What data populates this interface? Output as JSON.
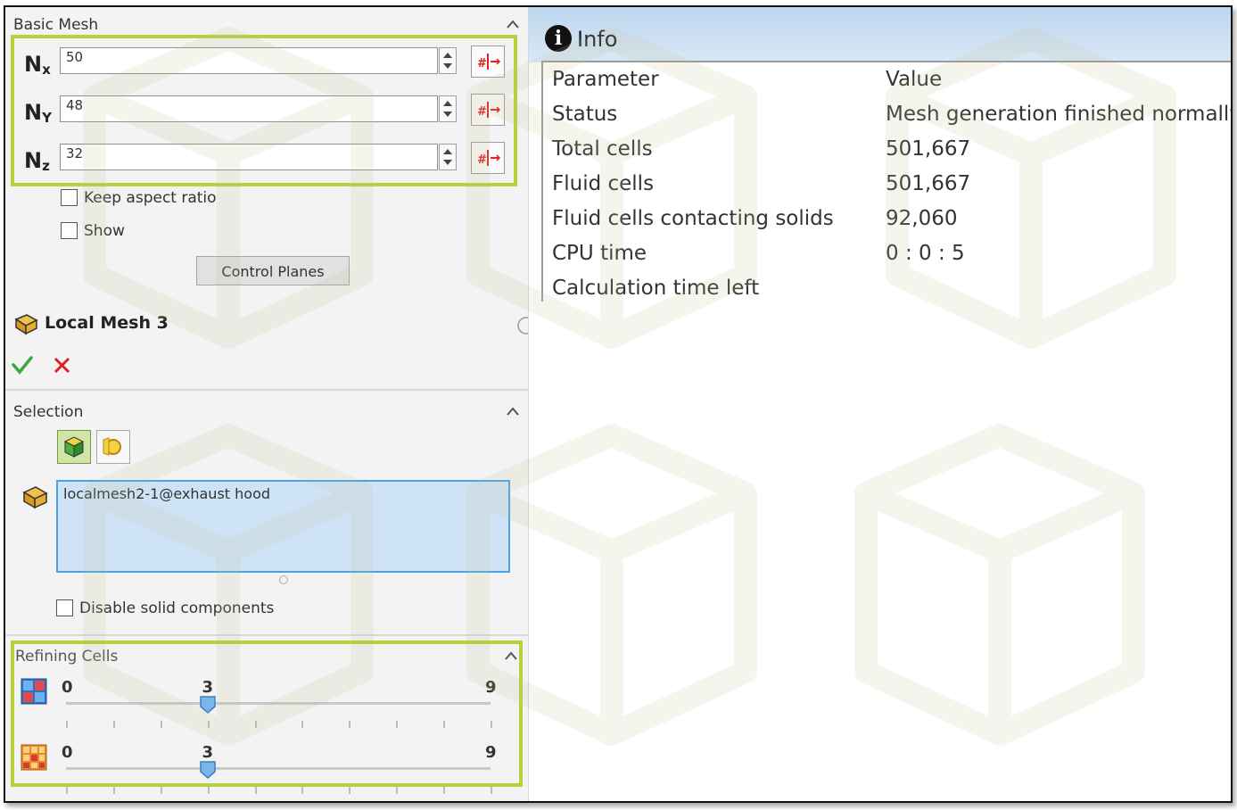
{
  "basic_mesh": {
    "title": "Basic Mesh",
    "nx": {
      "label": "N",
      "sub": "x",
      "value": "50"
    },
    "ny": {
      "label": "N",
      "sub": "Y",
      "value": "48"
    },
    "nz": {
      "label": "N",
      "sub": "z",
      "value": "32"
    },
    "keep_aspect_ratio": "Keep aspect ratio",
    "show": "Show",
    "control_planes": "Control Planes"
  },
  "local_mesh": {
    "title": "Local Mesh 3"
  },
  "selection": {
    "title": "Selection",
    "item": "localmesh2-1@exhaust hood",
    "disable_solid": "Disable solid components"
  },
  "refining": {
    "title": "Refining Cells",
    "slider1": {
      "min": "0",
      "value": "3",
      "max": "9",
      "fraction": 0.333
    },
    "slider2": {
      "min": "0",
      "value": "3",
      "max": "9",
      "fraction": 0.333
    }
  },
  "info": {
    "title": "Info",
    "headers": {
      "param": "Parameter",
      "value": "Value"
    },
    "rows": [
      {
        "param": "Status",
        "value": "Mesh generation finished normally."
      },
      {
        "param": "Total cells",
        "value": "501,667"
      },
      {
        "param": "Fluid cells",
        "value": "501,667"
      },
      {
        "param": "Fluid cells contacting solids",
        "value": "92,060"
      },
      {
        "param": "CPU time",
        "value": "0 : 0 : 5"
      },
      {
        "param": "Calculation time left",
        "value": ""
      }
    ]
  },
  "colors": {
    "highlight_border": "#b6d13b",
    "selection_fill": "#cfe3f7",
    "selection_border": "#4ba3e3",
    "info_header": "#bdd6ee"
  }
}
